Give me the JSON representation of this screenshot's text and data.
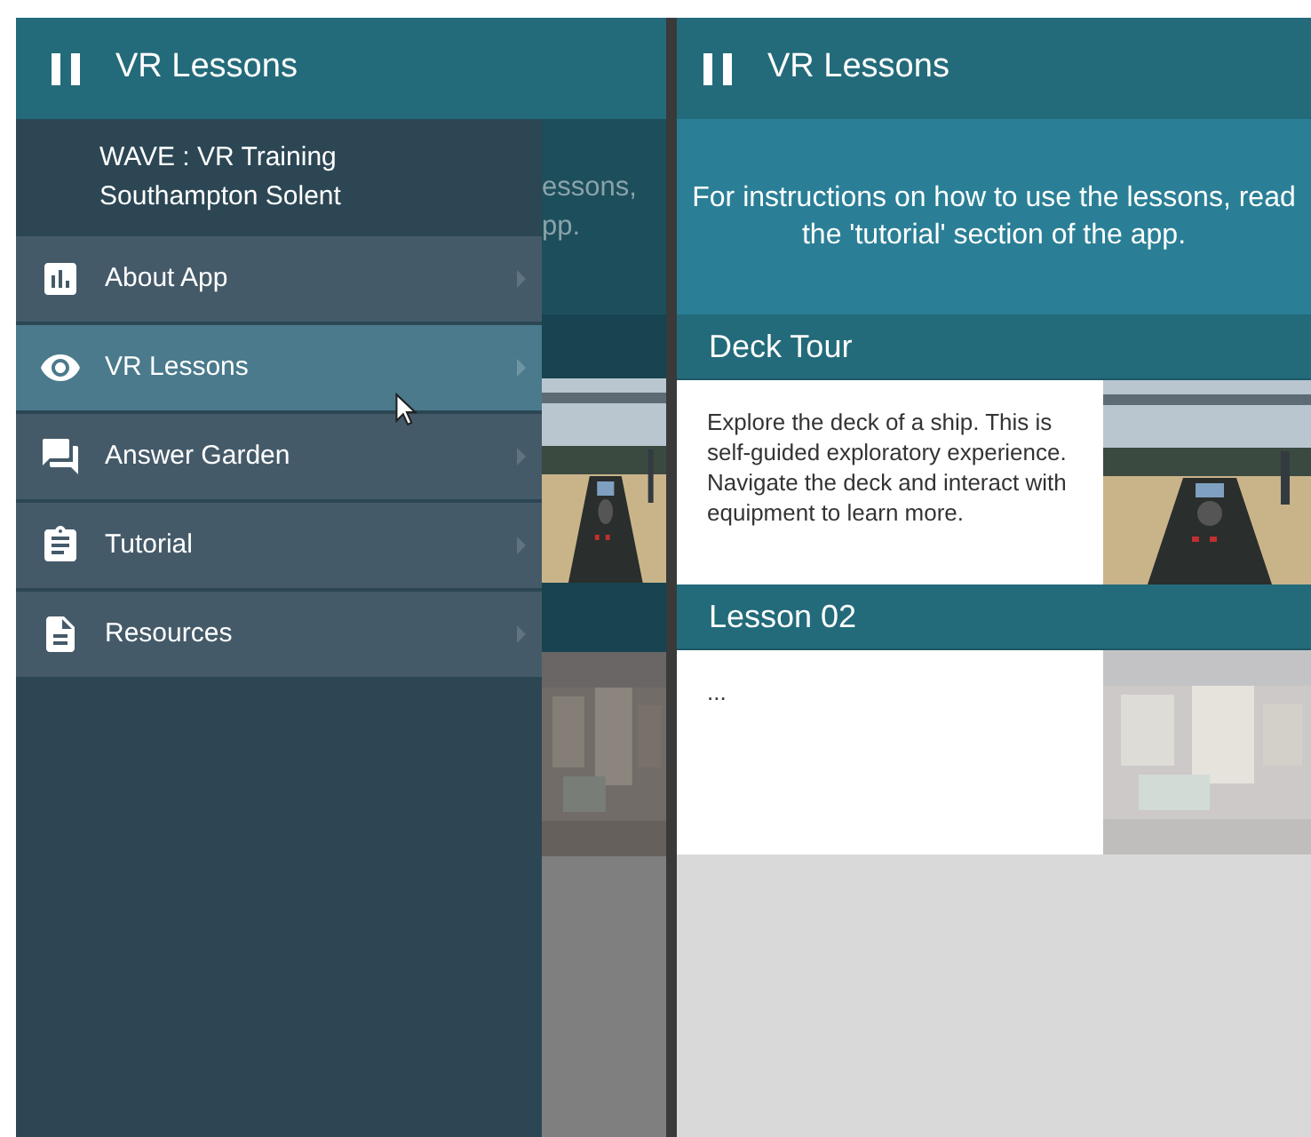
{
  "screens": [
    {
      "header": {
        "title": "VR Lessons"
      },
      "drawer": {
        "title": "WAVE : VR Training",
        "subtitle": "Southampton Solent",
        "items": [
          {
            "label": "About App",
            "kind": "chart",
            "selected": false
          },
          {
            "label": "VR Lessons",
            "kind": "eye",
            "selected": true
          },
          {
            "label": "Answer Garden",
            "kind": "chat",
            "selected": false
          },
          {
            "label": "Tutorial",
            "kind": "clipboard",
            "selected": false
          },
          {
            "label": "Resources",
            "kind": "document",
            "selected": false
          }
        ]
      },
      "background_fragments": [
        "essons,",
        "pp."
      ]
    },
    {
      "header": {
        "title": "VR Lessons"
      },
      "intro": "For instructions on how to use the lessons, read the 'tutorial' section of the app.",
      "lessons": [
        {
          "title": "Deck Tour",
          "description": "Explore the deck of a ship. This is self-guided exploratory experience. Navigate the deck and interact with equipment to learn more.",
          "faded": false
        },
        {
          "title": "Lesson 02",
          "description": "...",
          "faded": true
        }
      ]
    }
  ]
}
